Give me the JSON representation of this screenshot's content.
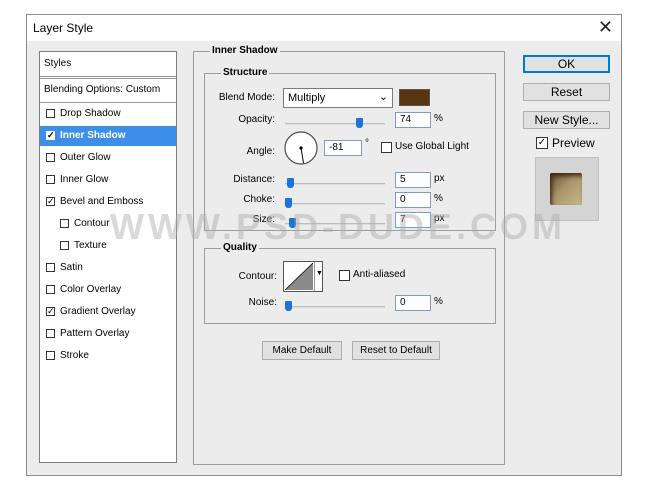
{
  "window": {
    "title": "Layer Style",
    "close_glyph": "✕"
  },
  "sidebar": {
    "header": "Styles",
    "blending": "Blending Options: Custom",
    "items": [
      {
        "label": "Drop Shadow",
        "checked": false,
        "selected": false
      },
      {
        "label": "Inner Shadow",
        "checked": true,
        "selected": true
      },
      {
        "label": "Outer Glow",
        "checked": false,
        "selected": false
      },
      {
        "label": "Inner Glow",
        "checked": false,
        "selected": false
      },
      {
        "label": "Bevel and Emboss",
        "checked": true,
        "selected": false
      },
      {
        "label": "Contour",
        "checked": false,
        "selected": false,
        "indent": true
      },
      {
        "label": "Texture",
        "checked": false,
        "selected": false,
        "indent": true
      },
      {
        "label": "Satin",
        "checked": false,
        "selected": false
      },
      {
        "label": "Color Overlay",
        "checked": false,
        "selected": false
      },
      {
        "label": "Gradient Overlay",
        "checked": true,
        "selected": false
      },
      {
        "label": "Pattern Overlay",
        "checked": false,
        "selected": false
      },
      {
        "label": "Stroke",
        "checked": false,
        "selected": false
      }
    ]
  },
  "inner_shadow": {
    "title": "Inner Shadow",
    "structure": {
      "title": "Structure",
      "blend_mode_label": "Blend Mode:",
      "blend_mode_value": "Multiply",
      "color": "#5a3310",
      "opacity_label": "Opacity:",
      "opacity_value": "74",
      "opacity_unit": "%",
      "opacity_level": 0.74,
      "angle_label": "Angle:",
      "angle_value": "-81",
      "angle_unit": "°",
      "global_light_label": "Use Global Light",
      "global_light_checked": false,
      "distance_label": "Distance:",
      "distance_value": "5",
      "distance_unit": "px",
      "choke_label": "Choke:",
      "choke_value": "0",
      "choke_unit": "%",
      "size_label": "Size:",
      "size_value": "7",
      "size_unit": "px"
    },
    "quality": {
      "title": "Quality",
      "contour_label": "Contour:",
      "anti_aliased_label": "Anti-aliased",
      "anti_aliased_checked": false,
      "noise_label": "Noise:",
      "noise_value": "0",
      "noise_unit": "%"
    },
    "make_default_label": "Make Default",
    "reset_default_label": "Reset to Default"
  },
  "actions": {
    "ok_label": "OK",
    "reset_label": "Reset",
    "new_style_label": "New Style...",
    "preview_label": "Preview",
    "preview_checked": true
  },
  "watermark": "WWW.PSD-DUDE.COM"
}
